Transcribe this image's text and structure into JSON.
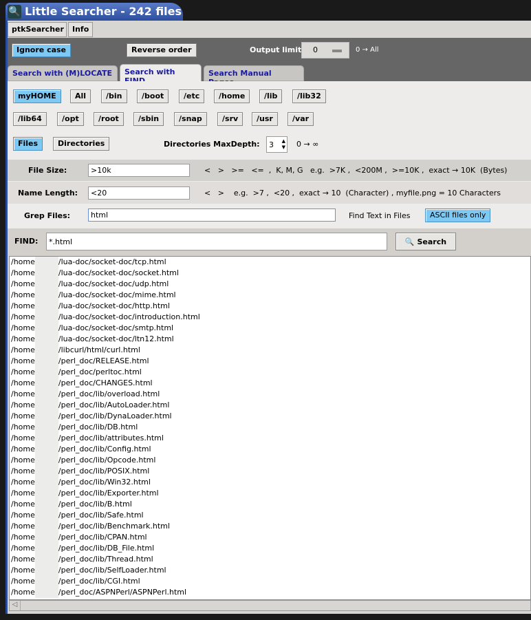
{
  "window": {
    "title": "Little Searcher - 242 files"
  },
  "menu": {
    "items": [
      "ptkSearcher",
      "Info"
    ]
  },
  "options": {
    "ignore_case": "Ignore case",
    "reverse_order": "Reverse order",
    "output_limit_label": "Output limit",
    "output_limit_value": "0",
    "output_limit_hint": "0 → All"
  },
  "tabs": [
    {
      "label": "Search with (M)LOCATE"
    },
    {
      "label": "Search with FIND",
      "active": true
    },
    {
      "label": "Search Manual Pages"
    }
  ],
  "dirs_row1": [
    "myHOME",
    "All",
    "/bin",
    "/boot",
    "/etc",
    "/home",
    "/lib",
    "/lib32"
  ],
  "dirs_row2": [
    "/lib64",
    "/opt",
    "/root",
    "/sbin",
    "/snap",
    "/srv",
    "/usr",
    "/var"
  ],
  "type": {
    "files": "Files",
    "directories": "Directories",
    "maxdepth_label": "Directories MaxDepth:",
    "maxdepth_value": "3",
    "maxdepth_hint": "0 → ∞"
  },
  "filesize": {
    "label": "File Size:",
    "value": ">10k",
    "hint": "<   >   >=   <=  ,  K, M, G   e.g.  >7K ,  <200M ,  >=10K ,  exact → 10K  (Bytes)"
  },
  "namelength": {
    "label": "Name Length:",
    "value": "<20",
    "hint": "<   >    e.g.  >7 ,  <20 ,  exact → 10  (Character) , myfile.png = 10 Characters"
  },
  "grep": {
    "label": "Grep Files:",
    "value": "html",
    "hint": "Find Text in Files",
    "ascii": "ASCII files only"
  },
  "find": {
    "label": "FIND:",
    "value": "*.html",
    "search": "Search"
  },
  "results": {
    "prefix": "/home",
    "items": [
      "/lua-doc/socket-doc/tcp.html",
      "/lua-doc/socket-doc/socket.html",
      "/lua-doc/socket-doc/udp.html",
      "/lua-doc/socket-doc/mime.html",
      "/lua-doc/socket-doc/http.html",
      "/lua-doc/socket-doc/introduction.html",
      "/lua-doc/socket-doc/smtp.html",
      "/lua-doc/socket-doc/ltn12.html",
      "/libcurl/html/curl.html",
      "/perl_doc/RELEASE.html",
      "/perl_doc/perltoc.html",
      "/perl_doc/CHANGES.html",
      "/perl_doc/lib/overload.html",
      "/perl_doc/lib/AutoLoader.html",
      "/perl_doc/lib/DynaLoader.html",
      "/perl_doc/lib/DB.html",
      "/perl_doc/lib/attributes.html",
      "/perl_doc/lib/Config.html",
      "/perl_doc/lib/Opcode.html",
      "/perl_doc/lib/POSIX.html",
      "/perl_doc/lib/Win32.html",
      "/perl_doc/lib/Exporter.html",
      "/perl_doc/lib/B.html",
      "/perl_doc/lib/Safe.html",
      "/perl_doc/lib/Benchmark.html",
      "/perl_doc/lib/CPAN.html",
      "/perl_doc/lib/DB_File.html",
      "/perl_doc/lib/Thread.html",
      "/perl_doc/lib/SelfLoader.html",
      "/perl_doc/lib/CGI.html",
      "/perl_doc/ASPNPerl/ASPNPerl.html"
    ]
  },
  "colors": {
    "accent": "#7ec8f4",
    "title": "#2a4c9c",
    "tab_text": "#1a1aa0"
  }
}
